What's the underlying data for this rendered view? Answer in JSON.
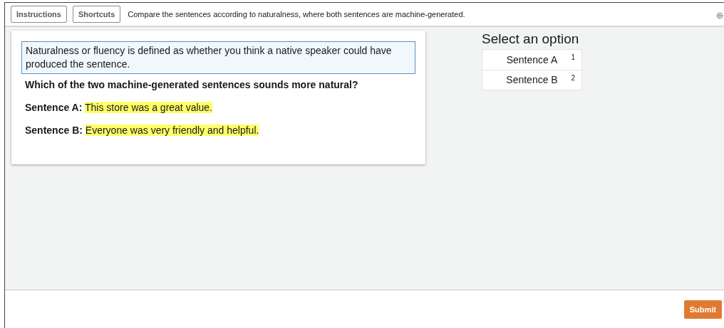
{
  "toolbar": {
    "buttons": [
      "Instructions",
      "Shortcuts"
    ],
    "task_description": "Compare the sentences according to naturalness, where both sentences are machine-generated."
  },
  "card": {
    "definition": "Naturalness or fluency is defined as whether you think a native speaker could have produced the sentence.",
    "question": "Which of the two machine-generated sentences sounds more natural?",
    "sentences": [
      {
        "label": "Sentence A:",
        "text": "This store was a great value."
      },
      {
        "label": "Sentence B:",
        "text": "Everyone was very friendly and helpful."
      }
    ]
  },
  "options_panel": {
    "title": "Select an option",
    "options": [
      {
        "label": "Sentence A",
        "shortcut": "1",
        "selected": false
      },
      {
        "label": "Sentence B",
        "shortcut": "2",
        "selected": false
      }
    ]
  },
  "footer": {
    "submit": "Submit"
  }
}
